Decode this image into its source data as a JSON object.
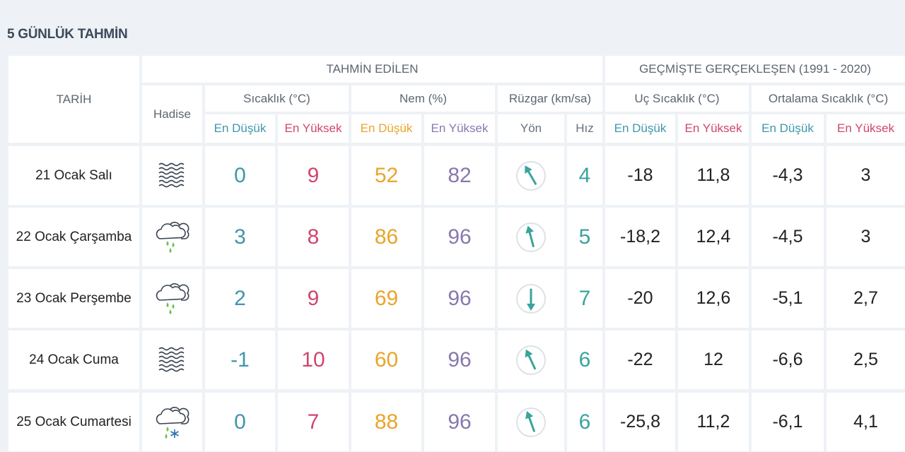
{
  "title": "5 GÜNLÜK TAHMİN",
  "headers": {
    "tarih": "TARİH",
    "tahmin_edilen": "TAHMİN EDİLEN",
    "gecmiste": "GEÇMİŞTE GERÇEKLEŞEN (1991 - 2020)",
    "hadise": "Hadise",
    "sicaklik": "Sıcaklık (°C)",
    "nem": "Nem (%)",
    "ruzgar": "Rüzgar (km/sa)",
    "uc_sicaklik": "Uç Sıcaklık (°C)",
    "ortalama_sicaklik": "Ortalama Sıcaklık (°C)",
    "en_dusuk": "En Düşük",
    "en_yuksek": "En Yüksek",
    "yon": "Yön",
    "hiz": "Hız"
  },
  "colors": {
    "blue": "#3f96ac",
    "red": "#cf466e",
    "orange": "#e8a52a",
    "purple": "#8878ae",
    "teal": "#38a49b"
  },
  "rows": [
    {
      "date": "21 Ocak Salı",
      "icon": "fog-icon",
      "temp_min": "0",
      "temp_max": "9",
      "hum_min": "52",
      "hum_max": "82",
      "wind_dir_deg": 330,
      "wind_speed": "4",
      "extreme_min": "-18",
      "extreme_max": "11,8",
      "avg_min": "-4,3",
      "avg_max": "3"
    },
    {
      "date": "22 Ocak Çarşamba",
      "icon": "cloud-rain-icon",
      "temp_min": "3",
      "temp_max": "8",
      "hum_min": "86",
      "hum_max": "96",
      "wind_dir_deg": 345,
      "wind_speed": "5",
      "extreme_min": "-18,2",
      "extreme_max": "12,4",
      "avg_min": "-4,5",
      "avg_max": "3"
    },
    {
      "date": "23 Ocak Perşembe",
      "icon": "cloud-rain-icon",
      "temp_min": "2",
      "temp_max": "9",
      "hum_min": "69",
      "hum_max": "96",
      "wind_dir_deg": 180,
      "wind_speed": "7",
      "extreme_min": "-20",
      "extreme_max": "12,6",
      "avg_min": "-5,1",
      "avg_max": "2,7"
    },
    {
      "date": "24 Ocak Cuma",
      "icon": "fog-icon",
      "temp_min": "-1",
      "temp_max": "10",
      "hum_min": "60",
      "hum_max": "96",
      "wind_dir_deg": 335,
      "wind_speed": "6",
      "extreme_min": "-22",
      "extreme_max": "12",
      "avg_min": "-6,6",
      "avg_max": "2,5"
    },
    {
      "date": "25 Ocak Cumartesi",
      "icon": "cloud-rain-snow-icon",
      "temp_min": "0",
      "temp_max": "7",
      "hum_min": "88",
      "hum_max": "96",
      "wind_dir_deg": 340,
      "wind_speed": "6",
      "extreme_min": "-25,8",
      "extreme_max": "11,2",
      "avg_min": "-6,1",
      "avg_max": "4,1"
    }
  ]
}
